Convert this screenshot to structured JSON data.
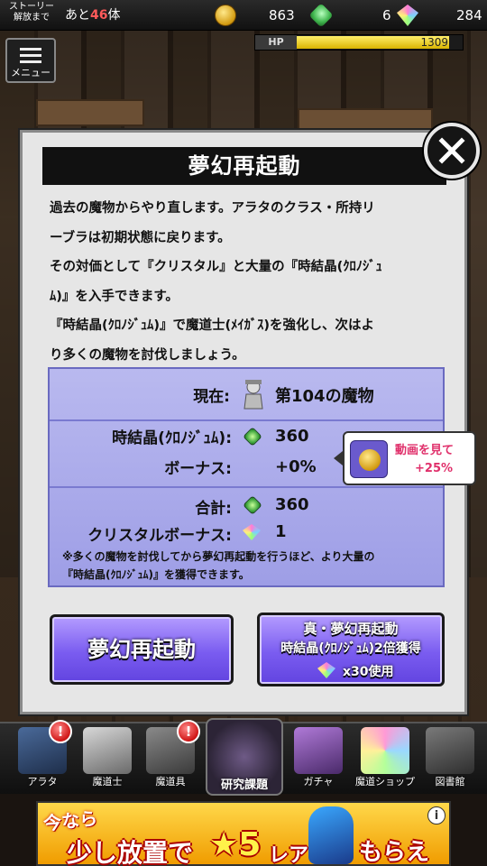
{
  "topbar": {
    "story_label_line1": "ストーリー",
    "story_label_line2": "解放まで",
    "story_prefix": "あと",
    "story_num": "46",
    "story_suffix": "体",
    "gold": "863",
    "crystal_cubes": "6",
    "gems": "284"
  },
  "hp": {
    "label": "HP",
    "value": "1309",
    "fill_fraction": 0.92
  },
  "menu": {
    "label": "メニュー"
  },
  "modal": {
    "title": "夢幻再起動",
    "desc_lines": [
      "過去の魔物からやり直します。アラタのクラス・所持リ",
      "ーブラは初期状態に戻ります。",
      "その対価として『クリスタル』と大量の『時結晶(ｸﾛﾉｼﾞｭ",
      "ﾑ)』を入手できます。",
      "『時結晶(ｸﾛﾉｼﾞｭﾑ)』で魔道士(ﾒｲｶﾞｽ)を強化し、次はよ",
      "り多くの魔物を討伐しましょう。"
    ],
    "info": {
      "current_label": "現在:",
      "current_value": "第104の魔物",
      "chronogium_label": "時結晶(ｸﾛﾉｼﾞｭﾑ):",
      "chronogium_value": "360",
      "bonus_label": "ボーナス:",
      "bonus_value": "+0%",
      "total_label": "合計:",
      "total_value": "360",
      "crystal_bonus_label": "クリスタルボーナス:",
      "crystal_bonus_value": "1",
      "note_line1": "※多くの魔物を討伐してから夢幻再起動を行うほど、より大量の",
      "note_line2": "『時結晶(ｸﾛﾉｼﾞｭﾑ)』を獲得できます。"
    },
    "video_bonus": {
      "line1": "動画を見て",
      "line2": "+25%"
    },
    "buttons": {
      "main": "夢幻再起動",
      "true_line1": "真・夢幻再起動",
      "true_line2": "時結晶(ｸﾛﾉｼﾞｭﾑ)2倍獲得",
      "true_line3": "x30使用"
    }
  },
  "nav": {
    "items": [
      {
        "label": "アラタ",
        "badge": "!"
      },
      {
        "label": "魔道士",
        "badge": ""
      },
      {
        "label": "魔道具",
        "badge": "!"
      },
      {
        "label": "研究課題",
        "badge": ""
      },
      {
        "label": "ガチャ",
        "badge": ""
      },
      {
        "label": "魔道ショップ",
        "badge": ""
      },
      {
        "label": "図書館",
        "badge": ""
      }
    ]
  },
  "ad": {
    "line1": "今なら",
    "line2": "少し放置で",
    "line3": "★5",
    "line4": "レア",
    "line5": "もらえる!",
    "info_icon": "i"
  },
  "colors": {
    "accent_purple": "#7a5cf0",
    "info_bg": "#aaaaea",
    "bonus_pink": "#e0306b"
  }
}
